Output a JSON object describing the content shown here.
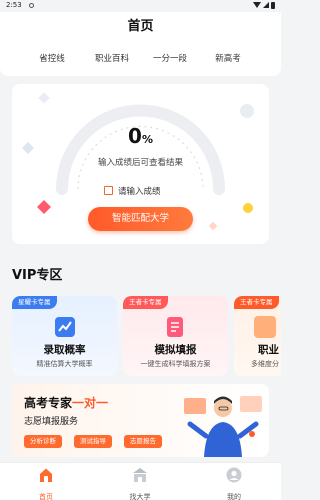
{
  "status_bar": {
    "time": "2:53"
  },
  "header": {
    "title": "首页"
  },
  "tabs": [
    {
      "label": "省控线"
    },
    {
      "label": "职业百科"
    },
    {
      "label": "一分一段"
    },
    {
      "label": "新高考"
    }
  ],
  "score_card": {
    "score": "0",
    "unit": "%",
    "hint": "输入成绩后可查看结果",
    "input_link": "请输入成绩",
    "button": "智能匹配大学"
  },
  "vip": {
    "title": "VIP专区",
    "cards": [
      {
        "badge": "星耀卡专属",
        "name": "录取概率",
        "desc": "精准估算大学概率",
        "accent": "#3b7df0"
      },
      {
        "badge": "王者卡专属",
        "name": "模拟填报",
        "desc": "一键生成科学填报方案",
        "accent": "#ff5a5a"
      },
      {
        "badge": "王者卡专属",
        "name": "职业",
        "desc": "多维度分",
        "accent": "#ff5a2a"
      }
    ]
  },
  "expert": {
    "title_main": "高考专家",
    "title_highlight": "一对一",
    "subtitle": "志愿填报服务",
    "tags": [
      "分析诊断",
      "测试指导",
      "志愿报告"
    ]
  },
  "bottom_nav": [
    {
      "label": "首页",
      "icon": "home-icon"
    },
    {
      "label": "找大学",
      "icon": "school-icon"
    },
    {
      "label": "我的",
      "icon": "profile-icon"
    }
  ],
  "colors": {
    "accent": "#ff5a2a",
    "blue": "#3b7df0"
  }
}
